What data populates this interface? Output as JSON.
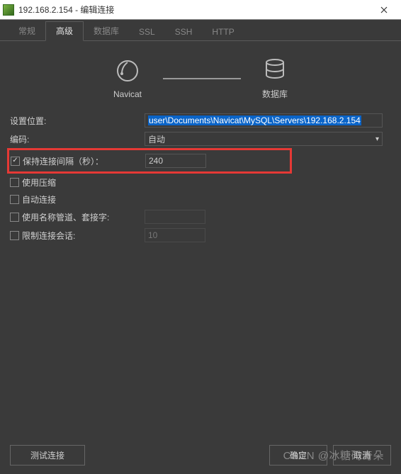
{
  "titlebar": {
    "title": "192.168.2.154 - 编辑连接"
  },
  "tabs": [
    {
      "label": "常规",
      "active": false
    },
    {
      "label": "高级",
      "active": true
    },
    {
      "label": "数据库",
      "active": false
    },
    {
      "label": "SSL",
      "active": false
    },
    {
      "label": "SSH",
      "active": false
    },
    {
      "label": "HTTP",
      "active": false
    }
  ],
  "diagram": {
    "left_label": "Navicat",
    "right_label": "数据库"
  },
  "fields": {
    "settings_location": {
      "label": "设置位置:",
      "value": "user\\Documents\\Navicat\\MySQL\\Servers\\192.168.2.154"
    },
    "encoding": {
      "label": "编码:",
      "value": "自动"
    },
    "keep_alive": {
      "label": "保持连接间隔（秒）：",
      "value": "240",
      "checked": true
    },
    "use_compression": {
      "label": "使用压缩",
      "checked": false
    },
    "auto_connect": {
      "label": "自动连接",
      "checked": false
    },
    "named_pipe": {
      "label": "使用名称管道、套接字:",
      "value": "",
      "checked": false
    },
    "limit_sessions": {
      "label": "限制连接会话:",
      "value": "10",
      "checked": false
    }
  },
  "footer": {
    "test": "测试连接",
    "ok": "确定",
    "cancel": "取消"
  },
  "watermark": "CSDN @冰糖码奇朵"
}
